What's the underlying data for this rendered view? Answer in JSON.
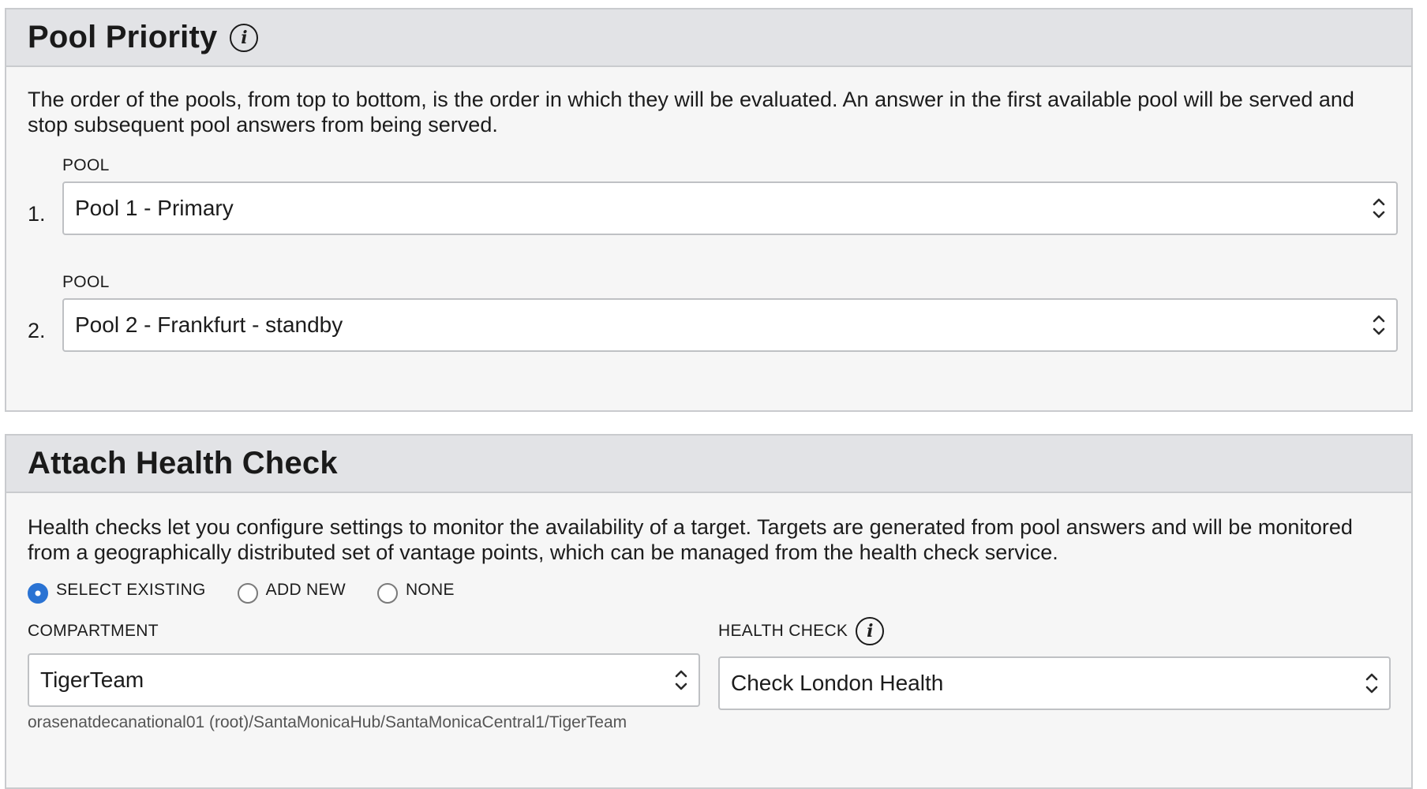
{
  "pool_priority": {
    "title": "Pool Priority",
    "info_icon": "info-icon",
    "description": "The order of the pools, from top to bottom, is the order in which they will be evaluated. An answer in the first available pool will be served and stop subsequent pool answers from being served.",
    "pools": [
      {
        "index": "1.",
        "label": "POOL",
        "value": "Pool 1 - Primary"
      },
      {
        "index": "2.",
        "label": "POOL",
        "value": "Pool 2 - Frankfurt - standby"
      }
    ]
  },
  "health_check": {
    "title": "Attach Health Check",
    "description": "Health checks let you configure settings to monitor the availability of a target. Targets are generated from pool answers and will be monitored from a geographically distributed set of vantage points, which can be managed from the health check service.",
    "options": [
      {
        "label": "SELECT EXISTING",
        "selected": true
      },
      {
        "label": "ADD NEW",
        "selected": false
      },
      {
        "label": "NONE",
        "selected": false
      }
    ],
    "compartment": {
      "label": "COMPARTMENT",
      "value": "TigerTeam",
      "path": "orasenatdecanational01 (root)/SantaMonicaHub/SantaMonicaCentral1/TigerTeam"
    },
    "check": {
      "label": "HEALTH CHECK",
      "info_icon": "info-icon",
      "value": "Check London Health"
    }
  },
  "colors": {
    "panel_bg": "#f6f6f6",
    "header_bg": "#e2e3e6",
    "border": "#c9cbce",
    "radio_selected": "#2a73d3"
  }
}
